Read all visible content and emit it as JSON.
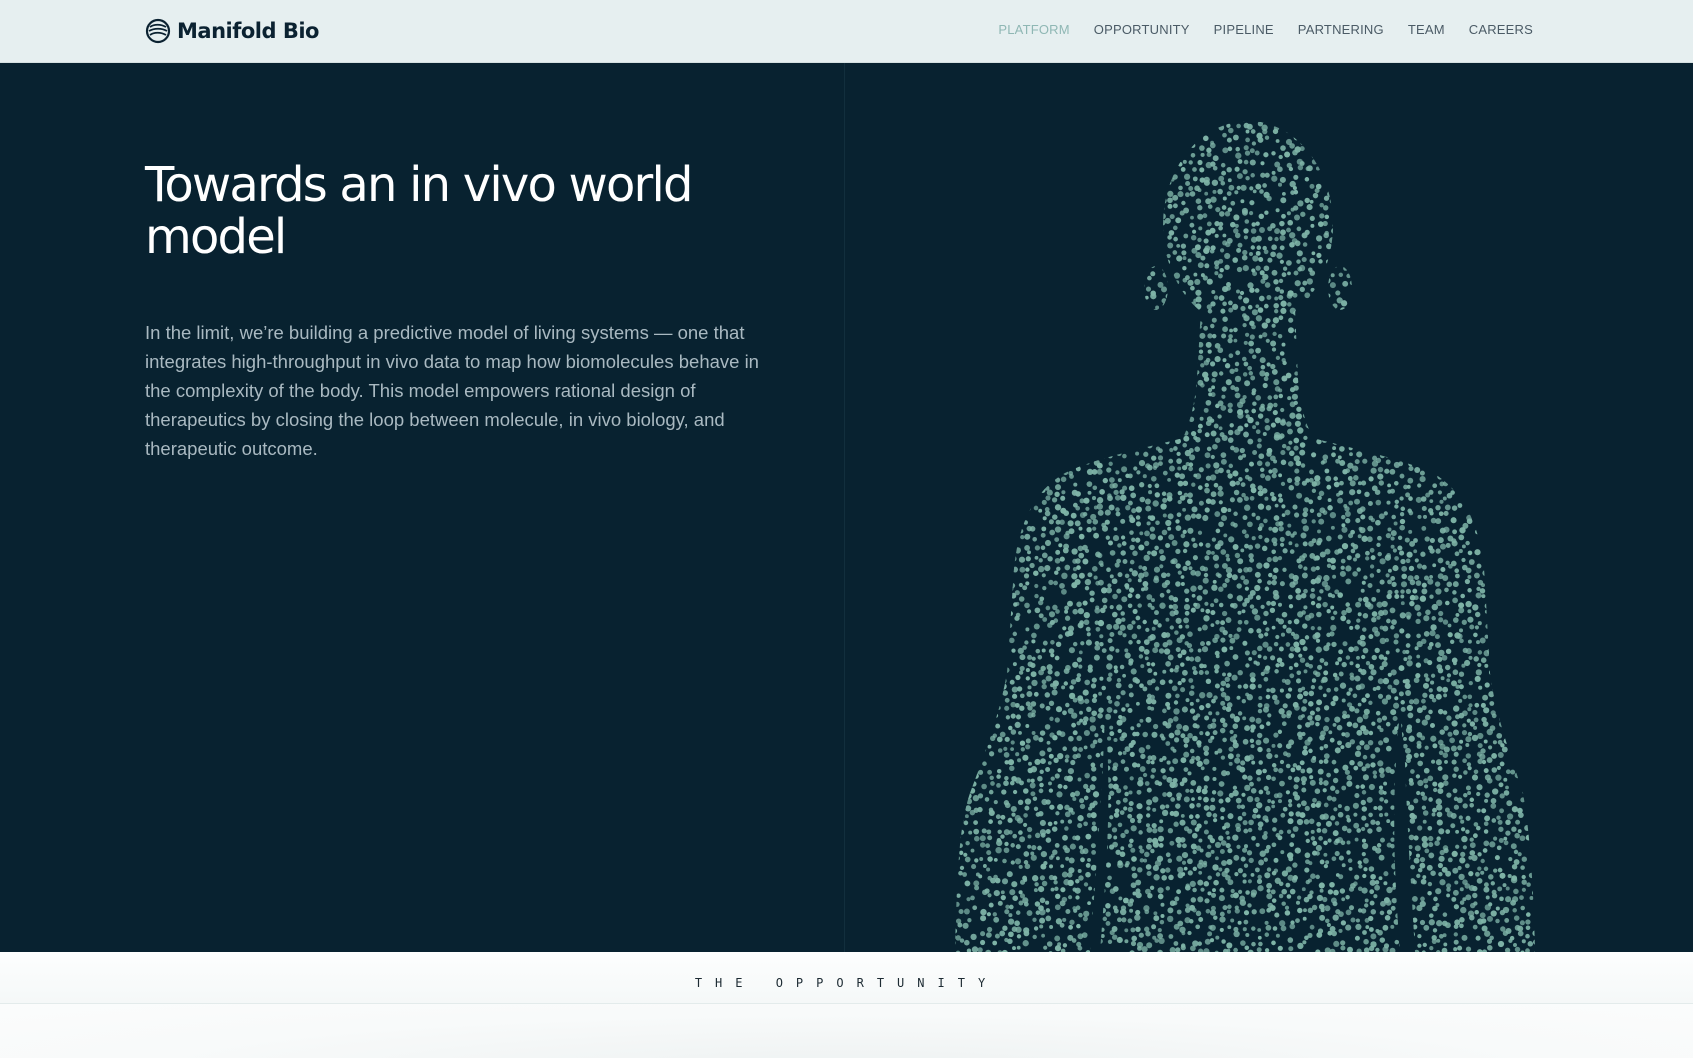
{
  "header": {
    "logo_text": "Manifold Bio",
    "nav": [
      {
        "label": "PLATFORM",
        "active": true
      },
      {
        "label": "OPPORTUNITY",
        "active": false
      },
      {
        "label": "PIPELINE",
        "active": false
      },
      {
        "label": "PARTNERING",
        "active": false
      },
      {
        "label": "TEAM",
        "active": false
      },
      {
        "label": "CAREERS",
        "active": false
      }
    ]
  },
  "hero": {
    "title": "Towards an in vivo world model",
    "description": "In the limit, we’re building a predictive model of living systems — one that integrates high-throughput in vivo data to map how biomolecules behave in the complexity of the body. This model empowers rational design of therapeutics by closing the loop between molecule, in vivo biology, and therapeutic outcome.",
    "figure_icon": "human-silhouette-particles"
  },
  "section": {
    "label": "THE OPPORTUNITY"
  },
  "colors": {
    "header_bg": "#e6eff0",
    "hero_bg": "#082230",
    "accent": "#7fb5a8",
    "nav_active": "#8fb7b4",
    "nav_text": "#4b5b66",
    "text_light": "#a9b9c1"
  },
  "icons": {
    "logo": "manifold-logo-icon"
  }
}
